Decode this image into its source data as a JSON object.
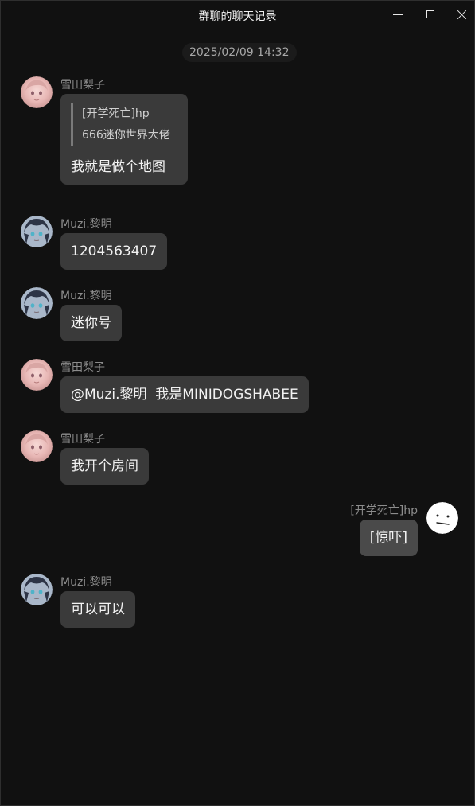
{
  "window": {
    "title": "群聊的聊天记录"
  },
  "timestamp": "2025/02/09 14:32",
  "messages": [
    {
      "sender": "雪田梨子",
      "avatar": "anime-girl-pink-avatar",
      "quote": {
        "sender": "[开学死亡]hp",
        "text": "666迷你世界大佬"
      },
      "text": "我就是做个地图"
    },
    {
      "sender": "Muzi.黎明",
      "avatar": "anime-boy-dark-avatar",
      "text": "1204563407"
    },
    {
      "sender": "Muzi.黎明",
      "avatar": "anime-boy-dark-avatar",
      "text": "迷你号"
    },
    {
      "sender": "雪田梨子",
      "avatar": "anime-girl-pink-avatar",
      "text": "@Muzi.黎明  我是MINIDOGSHABEE"
    },
    {
      "sender": "雪田梨子",
      "avatar": "anime-girl-pink-avatar",
      "text": "我开个房间"
    },
    {
      "sender": "[开学死亡]hp",
      "avatar": "white-face-avatar",
      "text": "[惊吓]",
      "self": true
    },
    {
      "sender": "Muzi.黎明",
      "avatar": "anime-boy-dark-avatar",
      "text": "可以可以"
    }
  ],
  "colors": {
    "background": "#111111",
    "bubble": "#3a3a3a",
    "self_bubble": "#4a4a4a",
    "sender_text": "#8c8c8c"
  }
}
